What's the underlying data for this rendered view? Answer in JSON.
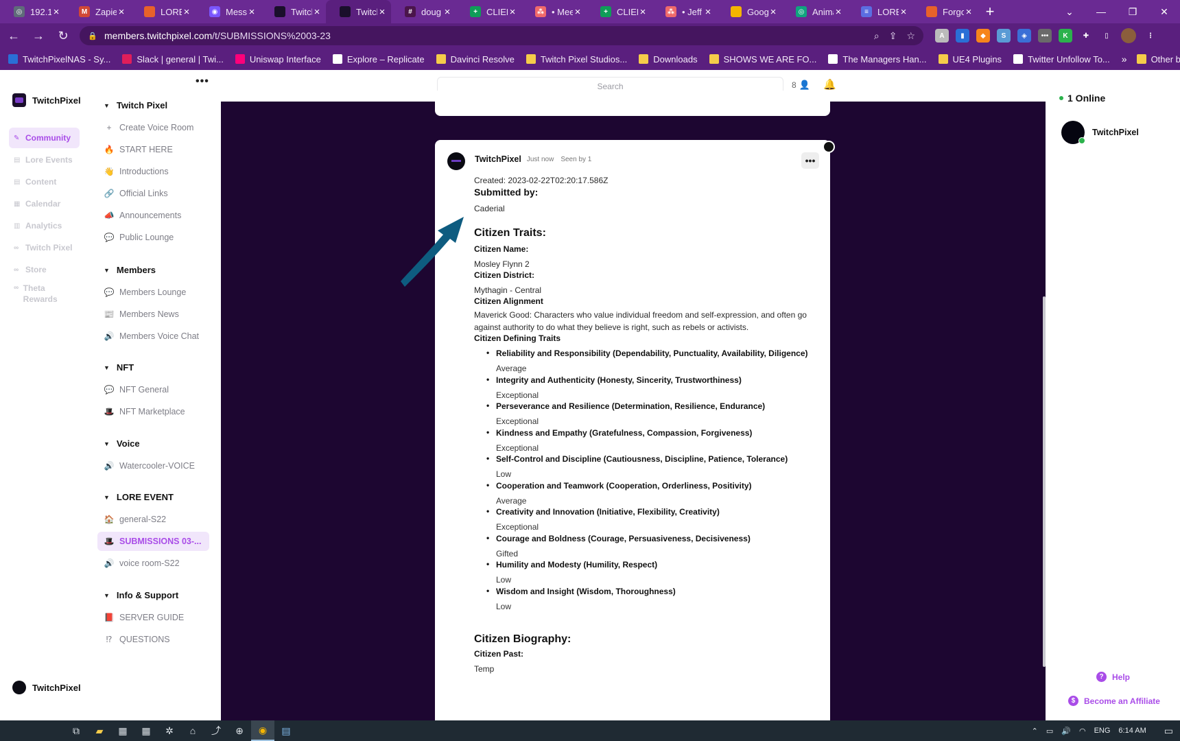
{
  "tabs": [
    {
      "label": "192.1(",
      "color": "#5f6b7a",
      "glyph": "◎"
    },
    {
      "label": "Zapier",
      "color": "#d14836",
      "glyph": "M"
    },
    {
      "label": "LORE",
      "color": "#e8622a",
      "glyph": ""
    },
    {
      "label": "Messe",
      "color": "#7a56ff",
      "glyph": "◉"
    },
    {
      "label": "Twitch",
      "color": "#1a0f2b",
      "glyph": ""
    },
    {
      "label": "Twitch",
      "color": "#1a0f2b",
      "glyph": ""
    },
    {
      "label": "doug",
      "color": "#4a154b",
      "glyph": "#"
    },
    {
      "label": "CLIEN",
      "color": "#0f9d58",
      "glyph": "+"
    },
    {
      "label": "• Mee",
      "color": "#f06a6a",
      "glyph": "⁂"
    },
    {
      "label": "CLIEN",
      "color": "#0f9d58",
      "glyph": "+"
    },
    {
      "label": "• Jeff",
      "color": "#f06a6a",
      "glyph": "⁂"
    },
    {
      "label": "Googl",
      "color": "#f4b400",
      "glyph": ""
    },
    {
      "label": "Anima",
      "color": "#10a37f",
      "glyph": "◎"
    },
    {
      "label": "LORE",
      "color": "#5b6ee1",
      "glyph": "≡"
    },
    {
      "label": "Forgo",
      "color": "#e8622a",
      "glyph": ""
    }
  ],
  "active_tab_index": 5,
  "address": {
    "host": "members.twitchpixel.com",
    "path": "/t/SUBMISSIONS%2003-23"
  },
  "bookmarks": [
    {
      "label": "TwitchPixelNAS - Sy...",
      "color": "#2a6fd6"
    },
    {
      "label": "Slack | general | Twi...",
      "color": "#e01e5a"
    },
    {
      "label": "Uniswap Interface",
      "color": "#ff007a"
    },
    {
      "label": "Explore – Replicate",
      "color": "#ffffff"
    },
    {
      "label": "Davinci Resolve",
      "color": "#f5cc4a"
    },
    {
      "label": "Twitch Pixel Studios...",
      "color": "#f5cc4a"
    },
    {
      "label": "Downloads",
      "color": "#f5cc4a"
    },
    {
      "label": "SHOWS WE ARE FO...",
      "color": "#f5cc4a"
    },
    {
      "label": "The Managers Han...",
      "color": "#ffffff"
    },
    {
      "label": "UE4 Plugins",
      "color": "#f5cc4a"
    },
    {
      "label": "Twitter Unfollow To...",
      "color": "#ffffff"
    }
  ],
  "bookmarks_more": "»",
  "bookmarks_other": "Other bookmarks",
  "brand": "TwitchPixel",
  "rail": [
    {
      "label": "Community",
      "icon": "✎"
    },
    {
      "label": "Lore Events",
      "icon": "▤"
    },
    {
      "label": "Content",
      "icon": "▤"
    },
    {
      "label": "Calendar",
      "icon": "▦"
    },
    {
      "label": "Analytics",
      "icon": "▥"
    },
    {
      "label": "Twitch Pixel",
      "icon": "∞"
    },
    {
      "label": "Store",
      "icon": "∞"
    },
    {
      "label": "Theta Rewards",
      "icon": "∞"
    }
  ],
  "rail_user": "TwitchPixel",
  "channels": {
    "sections": [
      {
        "title": "Twitch Pixel",
        "items": [
          {
            "label": "Create Voice Room",
            "icon": "+"
          },
          {
            "label": "START HERE",
            "icon": "🔥"
          },
          {
            "label": "Introductions",
            "icon": "👋"
          },
          {
            "label": "Official Links",
            "icon": "🔗"
          },
          {
            "label": "Announcements",
            "icon": "📣"
          },
          {
            "label": "Public Lounge",
            "icon": "💬"
          }
        ]
      },
      {
        "title": "Members",
        "items": [
          {
            "label": "Members Lounge",
            "icon": "💬"
          },
          {
            "label": "Members News",
            "icon": "📰"
          },
          {
            "label": "Members Voice Chat",
            "icon": "🔊"
          }
        ]
      },
      {
        "title": "NFT",
        "items": [
          {
            "label": "NFT General",
            "icon": "💬"
          },
          {
            "label": "NFT Marketplace",
            "icon": "🎩"
          }
        ]
      },
      {
        "title": "Voice",
        "items": [
          {
            "label": "Watercooler-VOICE",
            "icon": "🔊"
          }
        ]
      },
      {
        "title": "LORE EVENT",
        "items": [
          {
            "label": "general-S22",
            "icon": "🏠"
          },
          {
            "label": "SUBMISSIONS 03-...",
            "icon": "🎩"
          },
          {
            "label": "voice room-S22",
            "icon": "🔊"
          }
        ]
      },
      {
        "title": "Info & Support",
        "items": [
          {
            "label": "SERVER GUIDE",
            "icon": "📕"
          },
          {
            "label": "QUESTIONS",
            "icon": "⁉"
          }
        ]
      }
    ]
  },
  "search_placeholder": "Search",
  "members_count": "8",
  "post": {
    "author": "TwitchPixel",
    "time": "Just now",
    "seen": "Seen by 1",
    "created": "Created: 2023-02-22T02:20:17.586Z",
    "submitted_by_heading": "Submitted by:",
    "submitted_by": "Caderial",
    "traits_heading": "Citizen Traits:",
    "name_label": "Citizen Name:",
    "name": "Mosley Flynn 2",
    "district_label": "Citizen District:",
    "district": "Mythagin - Central",
    "alignment_label": "Citizen Alignment",
    "alignment": "Maverick Good: Characters who value individual freedom and self-expression, and often go against authority to do what they believe is right, such as rebels or activists.",
    "defining_label": "Citizen Defining Traits",
    "traits": [
      {
        "name": "Reliability and Responsibility (Dependability, Punctuality, Availability, Diligence)",
        "value": "Average"
      },
      {
        "name": "Integrity and Authenticity (Honesty, Sincerity, Trustworthiness)",
        "value": "Exceptional"
      },
      {
        "name": "Perseverance and Resilience (Determination, Resilience, Endurance)",
        "value": "Exceptional"
      },
      {
        "name": "Kindness and Empathy (Gratefulness, Compassion, Forgiveness)",
        "value": "Exceptional"
      },
      {
        "name": "Self-Control and Discipline (Cautiousness, Discipline, Patience, Tolerance)",
        "value": "Low"
      },
      {
        "name": "Cooperation and Teamwork (Cooperation, Orderliness, Positivity)",
        "value": "Average"
      },
      {
        "name": "Creativity and Innovation (Initiative, Flexibility, Creativity)",
        "value": "Exceptional"
      },
      {
        "name": "Courage and Boldness (Courage, Persuasiveness, Decisiveness)",
        "value": "Gifted"
      },
      {
        "name": "Humility and Modesty (Humility, Respect)",
        "value": "Low"
      },
      {
        "name": "Wisdom and Insight (Wisdom, Thoroughness)",
        "value": "Low"
      }
    ],
    "bio_heading": "Citizen Biography:",
    "past_label": "Citizen Past:",
    "past": "Temp"
  },
  "right": {
    "online": "1 Online",
    "user": "TwitchPixel",
    "help": "Help",
    "affiliate": "Become an Affiliate"
  },
  "taskbar": {
    "lang": "ENG",
    "time": "6:14 AM"
  }
}
